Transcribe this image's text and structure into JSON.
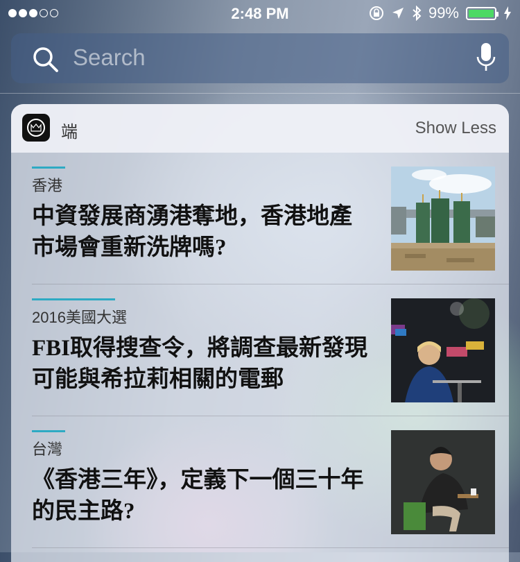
{
  "status": {
    "signal_total": 5,
    "signal_filled": 3,
    "time": "2:48 PM",
    "battery_percent": "99%",
    "battery_level": 0.99
  },
  "search": {
    "placeholder": "Search"
  },
  "widget": {
    "app_name": "端",
    "show_less": "Show Less",
    "articles": [
      {
        "category": "香港",
        "headline": "中資發展商湧港奪地，香港地產市場會重新洗牌嗎?"
      },
      {
        "category": "2016美國大選",
        "headline": "FBI取得搜查令，將調查最新發現可能與希拉莉相關的電郵"
      },
      {
        "category": "台灣",
        "headline": "《香港三年》，定義下一個三十年的民主路?"
      }
    ]
  },
  "colors": {
    "accent": "#2eaac3",
    "battery": "#4cd964"
  }
}
